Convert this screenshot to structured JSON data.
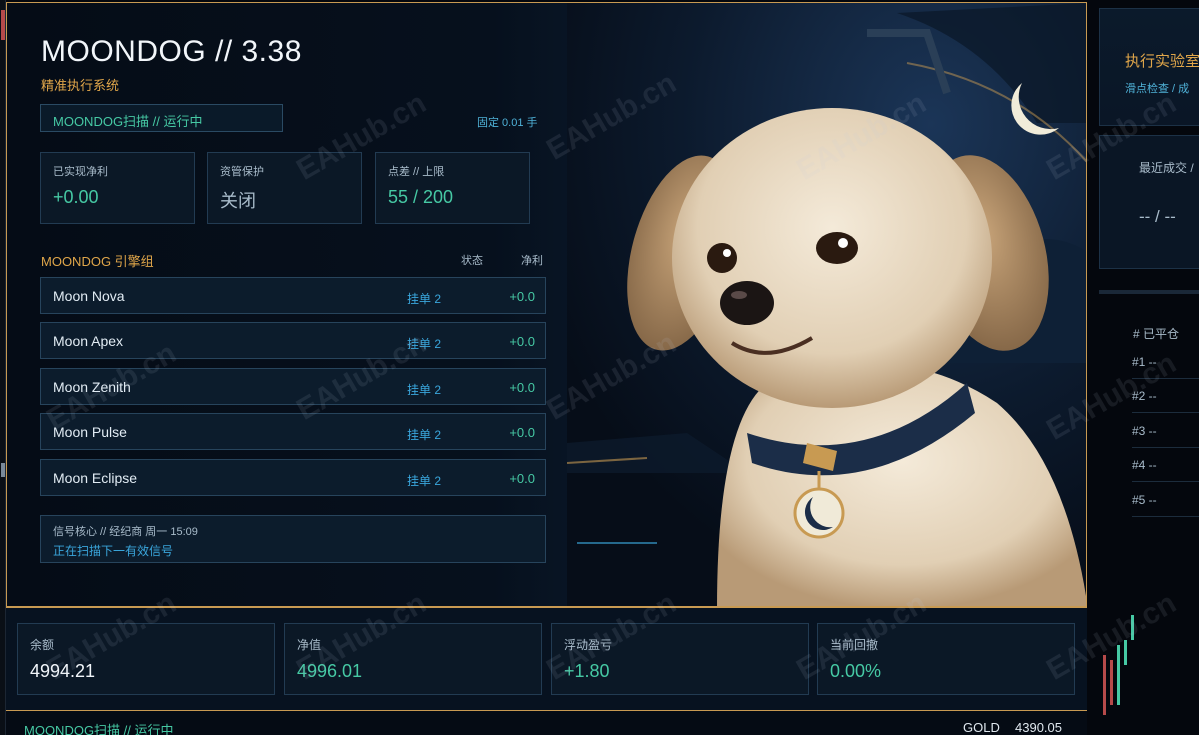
{
  "header": {
    "title": "MOONDOG // 3.38",
    "subtitle": "精准执行系统"
  },
  "status": {
    "pill": "MOONDOG扫描 // 运行中",
    "lot": "固定 0.01 手"
  },
  "stats": [
    {
      "label": "已实现净利",
      "value": "+0.00"
    },
    {
      "label": "资管保护",
      "value": "关闭"
    },
    {
      "label": "点差 // 上限",
      "value": "55 / 200"
    }
  ],
  "engines": {
    "title": "MOONDOG 引擎组",
    "col_state": "状态",
    "col_pnl": "净利",
    "rows": [
      {
        "name": "Moon Nova",
        "state": "挂单 2",
        "pnl": "+0.0"
      },
      {
        "name": "Moon Apex",
        "state": "挂单 2",
        "pnl": "+0.0"
      },
      {
        "name": "Moon Zenith",
        "state": "挂单 2",
        "pnl": "+0.0"
      },
      {
        "name": "Moon Pulse",
        "state": "挂单 2",
        "pnl": "+0.0"
      },
      {
        "name": "Moon Eclipse",
        "state": "挂单 2",
        "pnl": "+0.0"
      }
    ]
  },
  "signal": {
    "line1": "信号核心 // 经纪商 周一 15:09",
    "line2": "正在扫描下一有效信号"
  },
  "account": [
    {
      "label": "余额",
      "value": "4994.21"
    },
    {
      "label": "净值",
      "value": "4996.01"
    },
    {
      "label": "浮动盈亏",
      "value": "+1.80"
    },
    {
      "label": "当前回撤",
      "value": "0.00%"
    }
  ],
  "footer": {
    "status": "MOONDOG扫描 // 运行中",
    "symbol": "GOLD",
    "price": "4390.05"
  },
  "right_panel": {
    "title": "执行实验室",
    "subtitle": "滑点检查 / 成",
    "recent": "最近成交 /",
    "recent_value": "-- / --",
    "closed_header": "#  已平仓",
    "closed_rows": [
      "#1 --",
      "#2 --",
      "#3 --",
      "#4 --",
      "#5 --"
    ]
  },
  "watermark": "EAHub.cn",
  "colors": {
    "accent_gold": "#c89a52",
    "title_orange": "#e0a64a",
    "positive_green": "#46c9a4",
    "info_blue": "#3aa6dc"
  }
}
